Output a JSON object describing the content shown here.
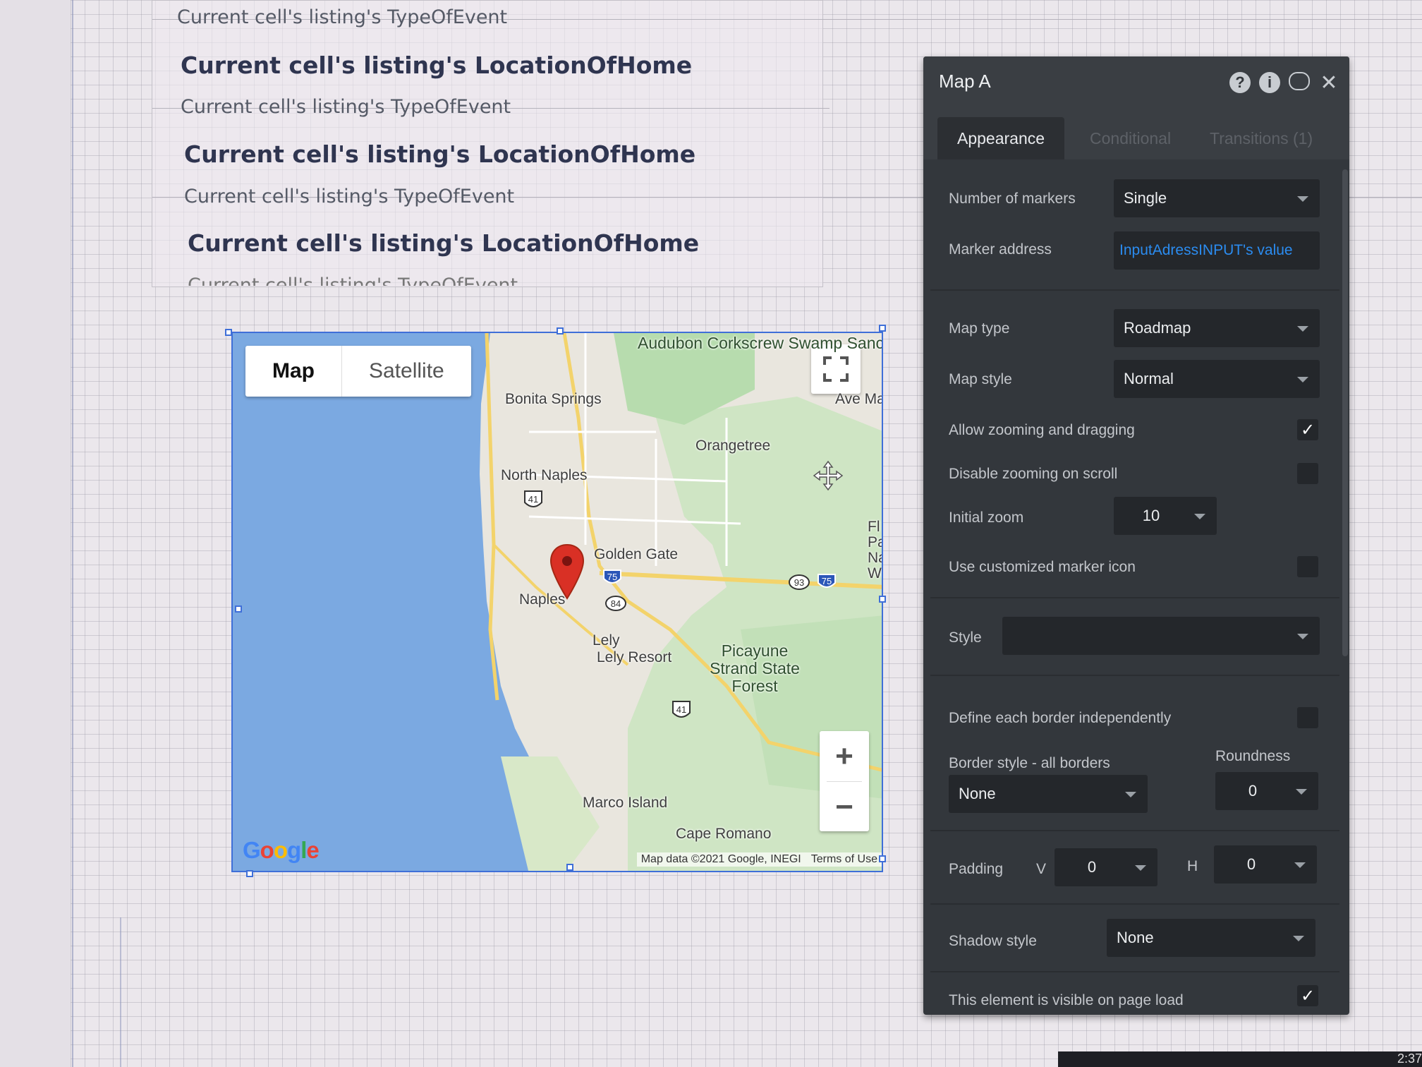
{
  "repeating_group": {
    "type_text": "Current cell's listing's TypeOfEvent",
    "location_text": "Current cell's listing's LocationOfHome"
  },
  "map": {
    "type_control": {
      "map_label": "Map",
      "satellite_label": "Satellite"
    },
    "labels": {
      "audubon": "Audubon Corkscrew Swamp Sanctuary-ONLINE...",
      "bonita": "Bonita Springs",
      "ave_maria": "Ave Ma",
      "orangetree": "Orangetree",
      "north_naples": "North Naples",
      "golden_gate": "Golden Gate",
      "naples": "Naples",
      "lely": "Lely",
      "lely_resort": "Lely Resort",
      "picayune": "Picayune Strand State Forest",
      "marco": "Marco Island",
      "cape_romano": "Cape Romano",
      "fl_partial": "Fl Pa Na Wi"
    },
    "shields": {
      "us41": "41",
      "i75": "75",
      "sr84": "84",
      "sr93": "93"
    },
    "google": "Google",
    "attribution": "Map data ©2021 Google, INEGI",
    "terms": "Terms of Use",
    "zoom_in": "+",
    "zoom_out": "−"
  },
  "panel": {
    "title": "Map A",
    "tabs": {
      "appearance": "Appearance",
      "conditional": "Conditional",
      "transitions": "Transitions (1)"
    },
    "fields": {
      "num_markers_label": "Number of markers",
      "num_markers_value": "Single",
      "marker_address_label": "Marker address",
      "marker_address_value": "InputAdressINPUT's value",
      "map_type_label": "Map type",
      "map_type_value": "Roadmap",
      "map_style_label": "Map style",
      "map_style_value": "Normal",
      "allow_zoom_label": "Allow zooming and dragging",
      "disable_scroll_label": "Disable zooming on scroll",
      "initial_zoom_label": "Initial zoom",
      "initial_zoom_value": "10",
      "custom_marker_label": "Use customized marker icon",
      "style_label": "Style",
      "style_value": "",
      "border_indep_label": "Define each border independently",
      "border_style_label": "Border style - all borders",
      "border_style_value": "None",
      "roundness_label": "Roundness",
      "roundness_value": "0",
      "padding_label": "Padding",
      "padding_v_label": "V",
      "padding_v_value": "0",
      "padding_h_label": "H",
      "padding_h_value": "0",
      "shadow_label": "Shadow style",
      "shadow_value": "None",
      "visible_label": "This element is visible on page load"
    },
    "checkboxes": {
      "allow_zoom": true,
      "disable_scroll": false,
      "custom_marker": false,
      "border_indep": false,
      "visible": true
    }
  },
  "taskbar": {
    "clock": "2:37"
  },
  "colors": {
    "selection": "#3f6fd8",
    "panel_bg": "#33373c",
    "link": "#2b8cf0",
    "water": "#7ba9e1",
    "land": "#e8e6df",
    "park": "#c6e3c0",
    "marker": "#d93025"
  }
}
